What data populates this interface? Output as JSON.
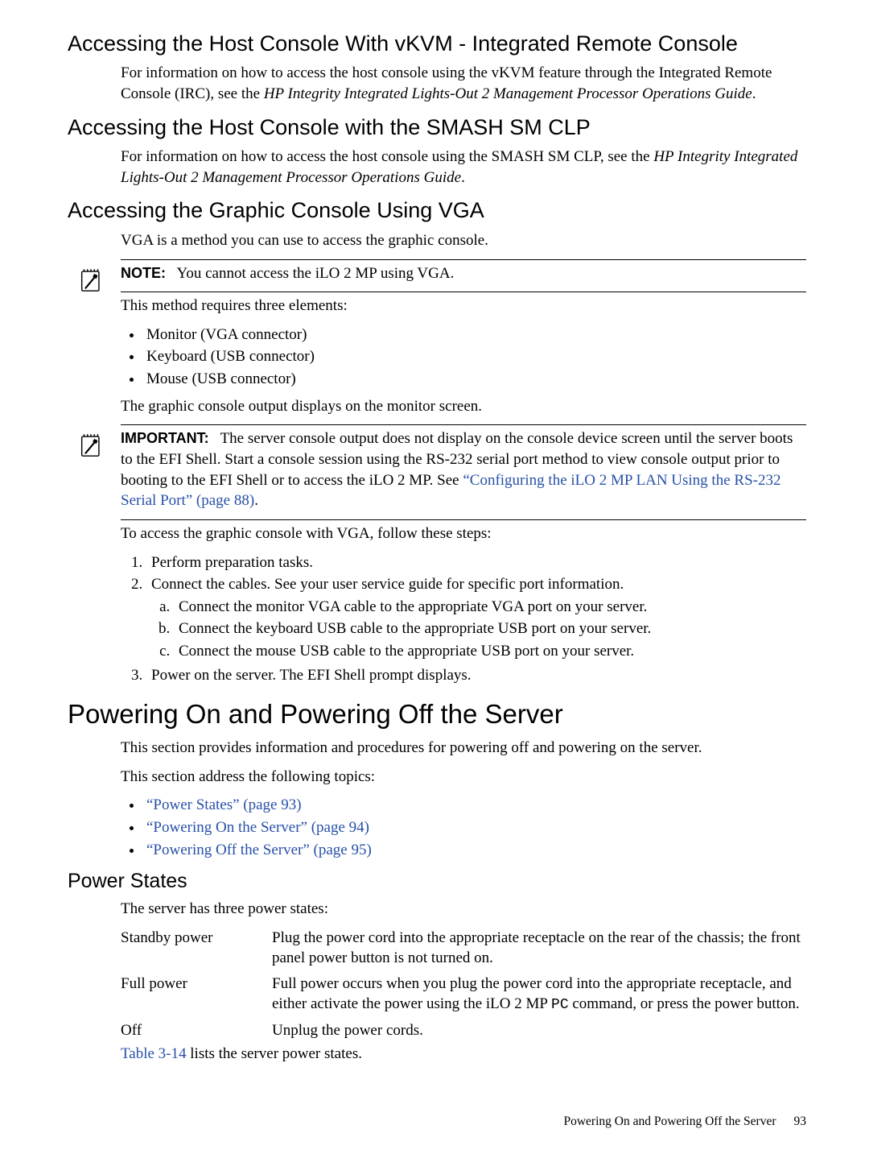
{
  "sec1": {
    "heading": "Accessing the Host Console With vKVM - Integrated Remote Console",
    "para": "For information on how to access the host console using the vKVM feature through the Integrated Remote Console (IRC), see the ",
    "para_em": "HP Integrity Integrated Lights-Out 2 Management Processor Operations Guide",
    "para_tail": "."
  },
  "sec2": {
    "heading": "Accessing the Host Console with the SMASH SM CLP",
    "para": "For information on how to access the host console using the SMASH SM CLP, see the ",
    "para_em": "HP Integrity Integrated Lights-Out 2 Management Processor Operations Guide",
    "para_tail": "."
  },
  "sec3": {
    "heading": "Accessing the Graphic Console Using VGA",
    "intro": "VGA is a method you can use to access the graphic console.",
    "note_label": "NOTE:",
    "note_text": "You cannot access the iLO 2 MP using VGA.",
    "requires": "This method requires three elements:",
    "bullets": [
      "Monitor (VGA connector)",
      "Keyboard (USB connector)",
      "Mouse (USB connector)"
    ],
    "output_line": "The graphic console output displays on the monitor screen.",
    "important_label": "IMPORTANT:",
    "important_text": "The server console output does not display on the console device screen until the server boots to the EFI Shell. Start a console session using the RS-232 serial port method to view console output prior to booting to the EFI Shell or to access the iLO 2 MP. See ",
    "important_link": "“Configuring the iLO 2 MP LAN Using the RS-232 Serial Port” (page 88)",
    "important_tail": ".",
    "steps_intro": "To access the graphic console with VGA, follow these steps:",
    "step1": "Perform preparation tasks.",
    "step2": "Connect the cables. See your user service guide for specific port information.",
    "step2a": "Connect the monitor VGA cable to the appropriate VGA port on your server.",
    "step2b": "Connect the keyboard USB cable to the appropriate USB port on your server.",
    "step2c": "Connect the mouse USB cable to the appropriate USB port on your server.",
    "step3": "Power on the server. The EFI Shell prompt displays."
  },
  "sec4": {
    "heading": "Powering On and Powering Off the Server",
    "para1": "This section provides information and procedures for powering off and powering on the server.",
    "para2": "This section address the following topics:",
    "links": [
      "“Power States” (page 93)",
      "“Powering On the Server” (page 94)",
      "“Powering Off the Server” (page 95)"
    ]
  },
  "sec5": {
    "heading": "Power States",
    "intro": "The server has three power states:",
    "rows": {
      "standby_label": "Standby power",
      "standby_desc": "Plug the power cord into the appropriate receptacle on the rear of the chassis; the front panel power button is not turned on.",
      "full_label": "Full power",
      "full_desc_a": "Full power occurs when you plug the power cord into the appropriate receptacle, and either activate the power using the iLO 2 MP ",
      "full_desc_mono": "PC",
      "full_desc_b": " command, or press the power button.",
      "off_label": "Off",
      "off_desc": "Unplug the power cords."
    },
    "tableref_link": "Table 3-14",
    "tableref_tail": " lists the server power states."
  },
  "footer": {
    "title": "Powering On and Powering Off the Server",
    "page": "93"
  }
}
